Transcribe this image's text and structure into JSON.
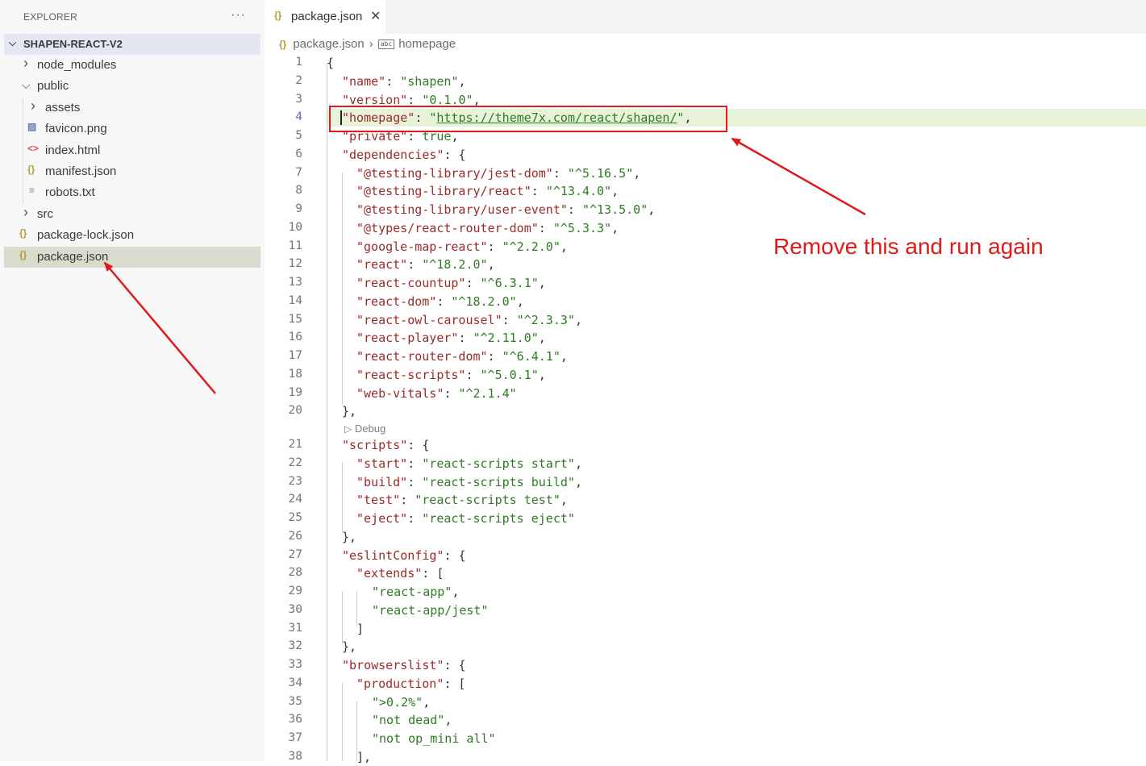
{
  "explorer": {
    "header": "EXPLORER",
    "more": "···",
    "project": "SHAPEN-REACT-V2",
    "items": [
      {
        "label": "node_modules",
        "kind": "folder",
        "expanded": false
      },
      {
        "label": "public",
        "kind": "folder",
        "expanded": true
      },
      {
        "label": "assets",
        "kind": "folder",
        "expanded": false
      },
      {
        "label": "favicon.png",
        "kind": "image"
      },
      {
        "label": "index.html",
        "kind": "html"
      },
      {
        "label": "manifest.json",
        "kind": "json"
      },
      {
        "label": "robots.txt",
        "kind": "text"
      },
      {
        "label": "src",
        "kind": "folder",
        "expanded": false
      },
      {
        "label": "package-lock.json",
        "kind": "json"
      },
      {
        "label": "package.json",
        "kind": "json",
        "selected": true
      }
    ]
  },
  "tab": {
    "label": "package.json",
    "close": "✕"
  },
  "breadcrumb": {
    "file": "package.json",
    "symbol": "homepage",
    "symbol_icon": "abc"
  },
  "editor": {
    "codelens": "Debug",
    "lines": [
      {
        "n": "1",
        "i": 0,
        "t": [
          [
            "p",
            "{"
          ]
        ]
      },
      {
        "n": "2",
        "i": 1,
        "t": [
          [
            "k",
            "\"name\""
          ],
          [
            "p",
            ": "
          ],
          [
            "s",
            "\"shapen\""
          ],
          [
            "p",
            ","
          ]
        ]
      },
      {
        "n": "3",
        "i": 1,
        "t": [
          [
            "k",
            "\"version\""
          ],
          [
            "p",
            ": "
          ],
          [
            "s",
            "\"0.1.0\""
          ],
          [
            "p",
            ","
          ]
        ]
      },
      {
        "n": "4",
        "i": 1,
        "t": [
          [
            "k",
            "\"homepage\""
          ],
          [
            "p",
            ": "
          ],
          [
            "s",
            "\""
          ],
          [
            "u",
            "https://theme7x.com/react/shapen/"
          ],
          [
            "s",
            "\""
          ],
          [
            "p",
            ","
          ]
        ],
        "active": true
      },
      {
        "n": "5",
        "i": 1,
        "t": [
          [
            "k",
            "\"private\""
          ],
          [
            "p",
            ": "
          ],
          [
            "s",
            "true"
          ],
          [
            "p",
            ","
          ]
        ]
      },
      {
        "n": "6",
        "i": 1,
        "t": [
          [
            "k",
            "\"dependencies\""
          ],
          [
            "p",
            ": {"
          ]
        ]
      },
      {
        "n": "7",
        "i": 2,
        "t": [
          [
            "k",
            "\"@testing-library/jest-dom\""
          ],
          [
            "p",
            ": "
          ],
          [
            "s",
            "\"^5.16.5\""
          ],
          [
            "p",
            ","
          ]
        ]
      },
      {
        "n": "8",
        "i": 2,
        "t": [
          [
            "k",
            "\"@testing-library/react\""
          ],
          [
            "p",
            ": "
          ],
          [
            "s",
            "\"^13.4.0\""
          ],
          [
            "p",
            ","
          ]
        ]
      },
      {
        "n": "9",
        "i": 2,
        "t": [
          [
            "k",
            "\"@testing-library/user-event\""
          ],
          [
            "p",
            ": "
          ],
          [
            "s",
            "\"^13.5.0\""
          ],
          [
            "p",
            ","
          ]
        ]
      },
      {
        "n": "10",
        "i": 2,
        "t": [
          [
            "k",
            "\"@types/react-router-dom\""
          ],
          [
            "p",
            ": "
          ],
          [
            "s",
            "\"^5.3.3\""
          ],
          [
            "p",
            ","
          ]
        ]
      },
      {
        "n": "11",
        "i": 2,
        "t": [
          [
            "k",
            "\"google-map-react\""
          ],
          [
            "p",
            ": "
          ],
          [
            "s",
            "\"^2.2.0\""
          ],
          [
            "p",
            ","
          ]
        ]
      },
      {
        "n": "12",
        "i": 2,
        "t": [
          [
            "k",
            "\"react\""
          ],
          [
            "p",
            ": "
          ],
          [
            "s",
            "\"^18.2.0\""
          ],
          [
            "p",
            ","
          ]
        ]
      },
      {
        "n": "13",
        "i": 2,
        "t": [
          [
            "k",
            "\"react-countup\""
          ],
          [
            "p",
            ": "
          ],
          [
            "s",
            "\"^6.3.1\""
          ],
          [
            "p",
            ","
          ]
        ]
      },
      {
        "n": "14",
        "i": 2,
        "t": [
          [
            "k",
            "\"react-dom\""
          ],
          [
            "p",
            ": "
          ],
          [
            "s",
            "\"^18.2.0\""
          ],
          [
            "p",
            ","
          ]
        ]
      },
      {
        "n": "15",
        "i": 2,
        "t": [
          [
            "k",
            "\"react-owl-carousel\""
          ],
          [
            "p",
            ": "
          ],
          [
            "s",
            "\"^2.3.3\""
          ],
          [
            "p",
            ","
          ]
        ]
      },
      {
        "n": "16",
        "i": 2,
        "t": [
          [
            "k",
            "\"react-player\""
          ],
          [
            "p",
            ": "
          ],
          [
            "s",
            "\"^2.11.0\""
          ],
          [
            "p",
            ","
          ]
        ]
      },
      {
        "n": "17",
        "i": 2,
        "t": [
          [
            "k",
            "\"react-router-dom\""
          ],
          [
            "p",
            ": "
          ],
          [
            "s",
            "\"^6.4.1\""
          ],
          [
            "p",
            ","
          ]
        ]
      },
      {
        "n": "18",
        "i": 2,
        "t": [
          [
            "k",
            "\"react-scripts\""
          ],
          [
            "p",
            ": "
          ],
          [
            "s",
            "\"^5.0.1\""
          ],
          [
            "p",
            ","
          ]
        ]
      },
      {
        "n": "19",
        "i": 2,
        "t": [
          [
            "k",
            "\"web-vitals\""
          ],
          [
            "p",
            ": "
          ],
          [
            "s",
            "\"^2.1.4\""
          ]
        ]
      },
      {
        "n": "20",
        "i": 1,
        "t": [
          [
            "p",
            "},"
          ]
        ]
      },
      {
        "n": "21",
        "i": 1,
        "t": [
          [
            "k",
            "\"scripts\""
          ],
          [
            "p",
            ": {"
          ]
        ]
      },
      {
        "n": "22",
        "i": 2,
        "t": [
          [
            "k",
            "\"start\""
          ],
          [
            "p",
            ": "
          ],
          [
            "s",
            "\"react-scripts start\""
          ],
          [
            "p",
            ","
          ]
        ]
      },
      {
        "n": "23",
        "i": 2,
        "t": [
          [
            "k",
            "\"build\""
          ],
          [
            "p",
            ": "
          ],
          [
            "s",
            "\"react-scripts build\""
          ],
          [
            "p",
            ","
          ]
        ]
      },
      {
        "n": "24",
        "i": 2,
        "t": [
          [
            "k",
            "\"test\""
          ],
          [
            "p",
            ": "
          ],
          [
            "s",
            "\"react-scripts test\""
          ],
          [
            "p",
            ","
          ]
        ]
      },
      {
        "n": "25",
        "i": 2,
        "t": [
          [
            "k",
            "\"eject\""
          ],
          [
            "p",
            ": "
          ],
          [
            "s",
            "\"react-scripts eject\""
          ]
        ]
      },
      {
        "n": "26",
        "i": 1,
        "t": [
          [
            "p",
            "},"
          ]
        ]
      },
      {
        "n": "27",
        "i": 1,
        "t": [
          [
            "k",
            "\"eslintConfig\""
          ],
          [
            "p",
            ": {"
          ]
        ]
      },
      {
        "n": "28",
        "i": 2,
        "t": [
          [
            "k",
            "\"extends\""
          ],
          [
            "p",
            ": ["
          ]
        ]
      },
      {
        "n": "29",
        "i": 3,
        "t": [
          [
            "s",
            "\"react-app\""
          ],
          [
            "p",
            ","
          ]
        ]
      },
      {
        "n": "30",
        "i": 3,
        "t": [
          [
            "s",
            "\"react-app/jest\""
          ]
        ]
      },
      {
        "n": "31",
        "i": 2,
        "t": [
          [
            "p",
            "]"
          ]
        ]
      },
      {
        "n": "32",
        "i": 1,
        "t": [
          [
            "p",
            "},"
          ]
        ]
      },
      {
        "n": "33",
        "i": 1,
        "t": [
          [
            "k",
            "\"browserslist\""
          ],
          [
            "p",
            ": {"
          ]
        ]
      },
      {
        "n": "34",
        "i": 2,
        "t": [
          [
            "k",
            "\"production\""
          ],
          [
            "p",
            ": ["
          ]
        ]
      },
      {
        "n": "35",
        "i": 3,
        "t": [
          [
            "s",
            "\">0.2%\""
          ],
          [
            "p",
            ","
          ]
        ]
      },
      {
        "n": "36",
        "i": 3,
        "t": [
          [
            "s",
            "\"not dead\""
          ],
          [
            "p",
            ","
          ]
        ]
      },
      {
        "n": "37",
        "i": 3,
        "t": [
          [
            "s",
            "\"not op_mini all\""
          ]
        ]
      },
      {
        "n": "38",
        "i": 2,
        "t": [
          [
            "p",
            "],"
          ]
        ]
      }
    ]
  },
  "annotation": {
    "text": "Remove this and run again",
    "color": "#e01919"
  }
}
